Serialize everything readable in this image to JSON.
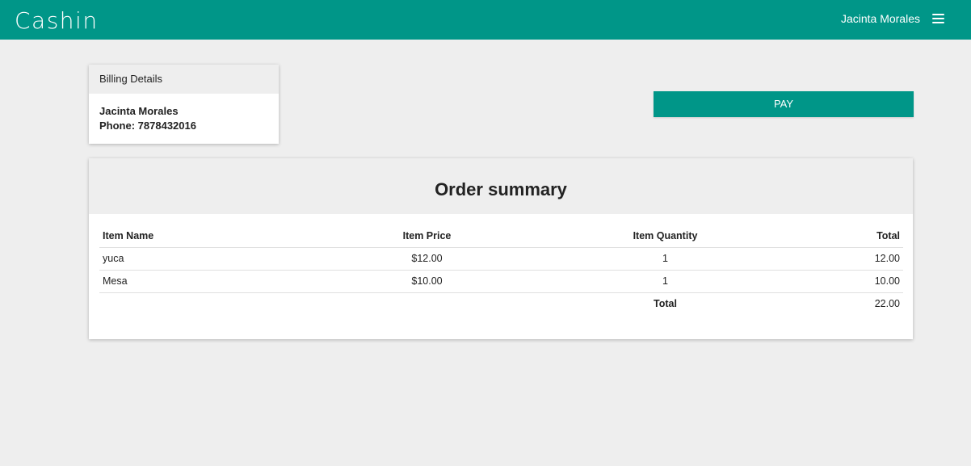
{
  "header": {
    "brand": "Cashin",
    "user_name": "Jacinta Morales",
    "menu_icon": "hamburger-menu-icon"
  },
  "billing": {
    "title": "Billing Details",
    "name": "Jacinta Morales",
    "phone": "Phone: 7878432016"
  },
  "pay_label": "PAY",
  "order": {
    "title": "Order summary",
    "columns": [
      "Item Name",
      "Item Price",
      "Item Quantity",
      "Total"
    ],
    "rows": [
      {
        "name": "yuca",
        "price": "$12.00",
        "quantity": "1",
        "total": "12.00"
      },
      {
        "name": "Mesa",
        "price": "$10.00",
        "quantity": "1",
        "total": "10.00"
      }
    ],
    "total_label": "Total",
    "grand_total": "22.00"
  },
  "colors": {
    "brand": "#009688",
    "background": "#eeeeee"
  }
}
